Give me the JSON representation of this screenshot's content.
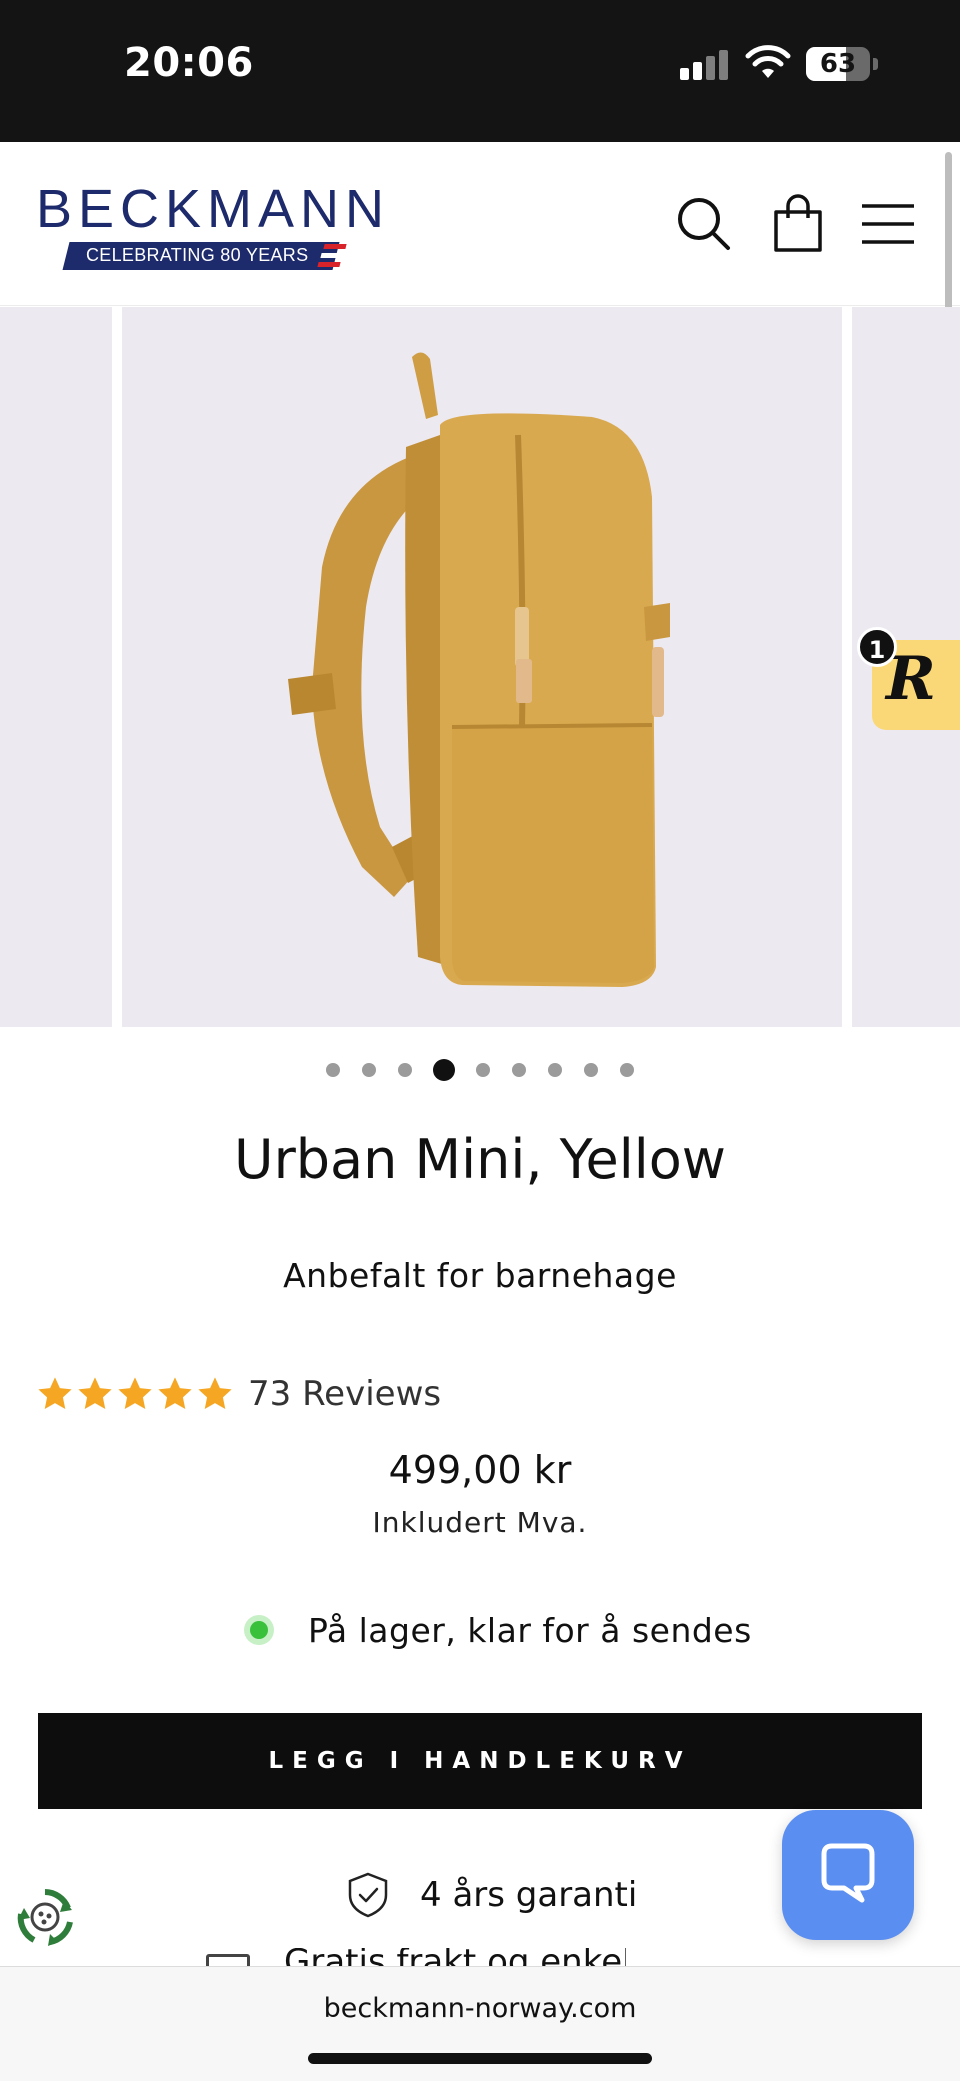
{
  "status_bar": {
    "time": "20:06",
    "battery": "63",
    "battery_level": 0.63
  },
  "header": {
    "logo_text": "BECKMANN",
    "logo_tagline": "CELEBRATING 80 YEARS",
    "brand_color": "#1d2a6b",
    "icons": [
      "search-icon",
      "shopping-bag-icon",
      "menu-icon"
    ]
  },
  "gallery": {
    "total_images": 9,
    "active_index": 3,
    "background_color": "#ece9f1",
    "product_color": "#d9a94f"
  },
  "rewards_badge": {
    "letter": "R",
    "count": "1",
    "color": "#fbd877"
  },
  "product": {
    "title": "Urban Mini, Yellow",
    "subtitle": "Anbefalt for barnehage",
    "rating_stars": 5,
    "reviews": "73 Reviews",
    "price": "499,00 kr",
    "vat_note": "Inkludert Mva.",
    "stock_status": "På lager, klar for å sendes",
    "stock_color": "#39c13c",
    "add_to_cart": "LEGG I HANDLEKURV",
    "warranty": "4 års garanti",
    "shipping_partial": "Gratis frakt og enkel"
  },
  "chat": {
    "color": "#5a8ef0"
  },
  "browser": {
    "url": "beckmann-norway.com"
  }
}
